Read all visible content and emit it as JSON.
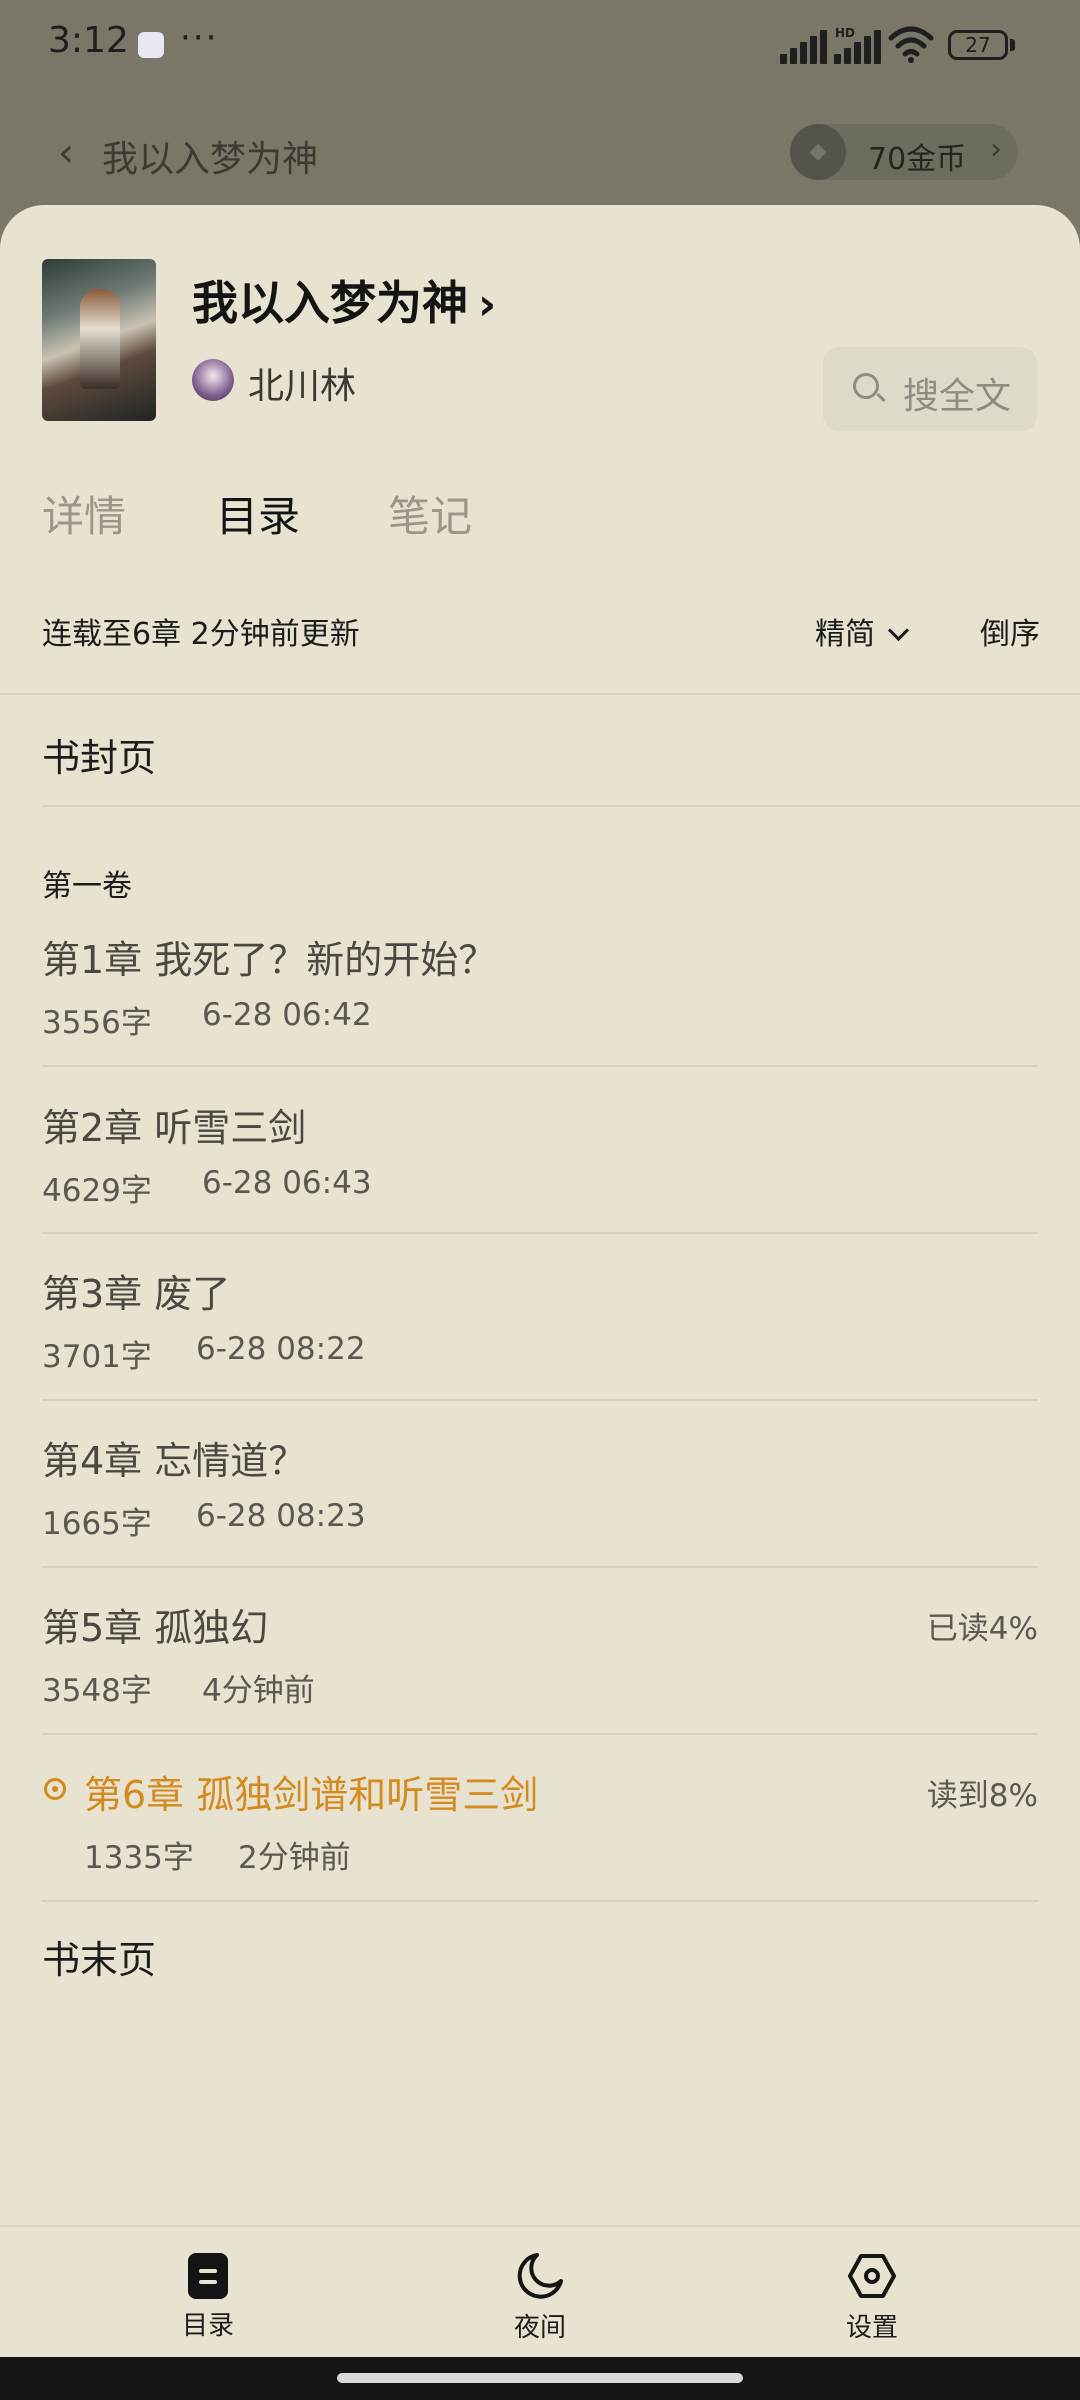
{
  "status_bar": {
    "time": "3:12",
    "dots": "···",
    "network": "HD",
    "battery": "27"
  },
  "header": {
    "back_label": "我以入梦为神",
    "coins": "70金币"
  },
  "book": {
    "title": "我以入梦为神",
    "author": "北川林"
  },
  "search": {
    "label": "搜全文"
  },
  "tabs": [
    "详情",
    "目录",
    "笔记"
  ],
  "toc": {
    "serial_info": "连载至6章 2分钟前更新",
    "variant": "精简",
    "sort": "倒序",
    "cover_page": "书封页",
    "volume": "第一卷",
    "chapters": [
      {
        "title": "第1章 我死了？新的开始？",
        "words": "3556字",
        "time": "6-28 06:42",
        "progress": ""
      },
      {
        "title": "第2章 听雪三剑",
        "words": "4629字",
        "time": "6-28 06:43",
        "progress": ""
      },
      {
        "title": "第3章 废了",
        "words": "3701字",
        "time": "6-28 08:22",
        "progress": ""
      },
      {
        "title": "第4章 忘情道？",
        "words": "1665字",
        "time": "6-28 08:23",
        "progress": ""
      },
      {
        "title": "第5章 孤独幻",
        "words": "3548字",
        "time": "4分钟前",
        "progress": "已读4%"
      },
      {
        "title": "第6章 孤独剑谱和听雪三剑",
        "words": "1335字",
        "time": "2分钟前",
        "progress": "读到8%"
      }
    ],
    "end_page": "书末页"
  },
  "bottom_nav": {
    "toc": "目录",
    "night": "夜间",
    "settings": "设置"
  },
  "colors": {
    "sheet": "#e8e3d1",
    "accent": "#d38a1e",
    "overlay": "#7a7769"
  },
  "icons": [
    "back-chevron-icon",
    "coin-icon",
    "search-icon",
    "current-chapter-icon",
    "toc-icon",
    "moon-icon",
    "settings-icon"
  ]
}
